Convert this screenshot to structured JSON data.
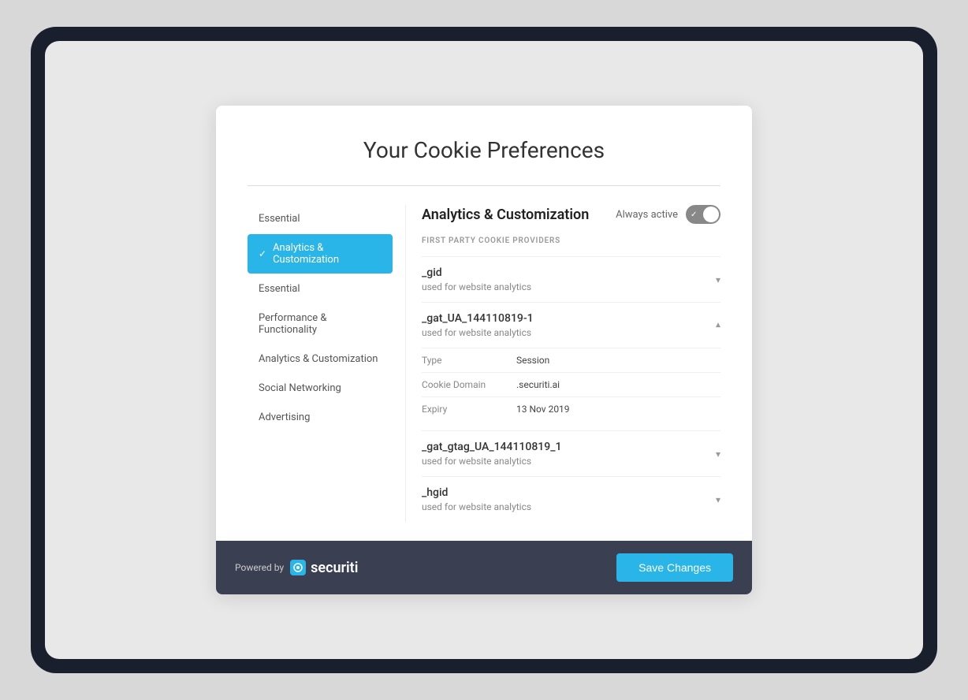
{
  "modal": {
    "title": "Your Cookie Preferences",
    "divider": true
  },
  "sidebar": {
    "items": [
      {
        "id": "essential-top",
        "label": "Essential",
        "active": false
      },
      {
        "id": "analytics-customization",
        "label": "Analytics & Customization",
        "active": true
      },
      {
        "id": "essential-bottom",
        "label": "Essential",
        "active": false
      },
      {
        "id": "performance-functionality",
        "label": "Performance & Functionality",
        "active": false
      },
      {
        "id": "analytics-customization-2",
        "label": "Analytics & Customization",
        "active": false
      },
      {
        "id": "social-networking",
        "label": "Social Networking",
        "active": false
      },
      {
        "id": "advertising",
        "label": "Advertising",
        "active": false
      }
    ]
  },
  "main": {
    "section_title": "Analytics & Customization",
    "always_active_label": "Always active",
    "providers_label": "FIRST PARTY COOKIE PROVIDERS",
    "cookies": [
      {
        "id": "gid",
        "name": "_gid",
        "description": "used for website analytics",
        "expanded": false,
        "details": []
      },
      {
        "id": "gat_ua",
        "name": "_gat_UA_144110819-1",
        "description": "used for website analytics",
        "expanded": true,
        "details": [
          {
            "label": "Type",
            "value": "Session"
          },
          {
            "label": "Cookie Domain",
            "value": ".securiti.ai"
          },
          {
            "label": "Expiry",
            "value": "13 Nov 2019"
          }
        ]
      },
      {
        "id": "gat_gtag",
        "name": "_gat_gtag_UA_144110819_1",
        "description": "used for website analytics",
        "expanded": false,
        "details": []
      },
      {
        "id": "hgid",
        "name": "_hgid",
        "description": "used for website analytics",
        "expanded": false,
        "details": []
      }
    ]
  },
  "footer": {
    "powered_by": "Powered by",
    "brand_name": "securiti",
    "save_button_label": "Save Changes"
  }
}
